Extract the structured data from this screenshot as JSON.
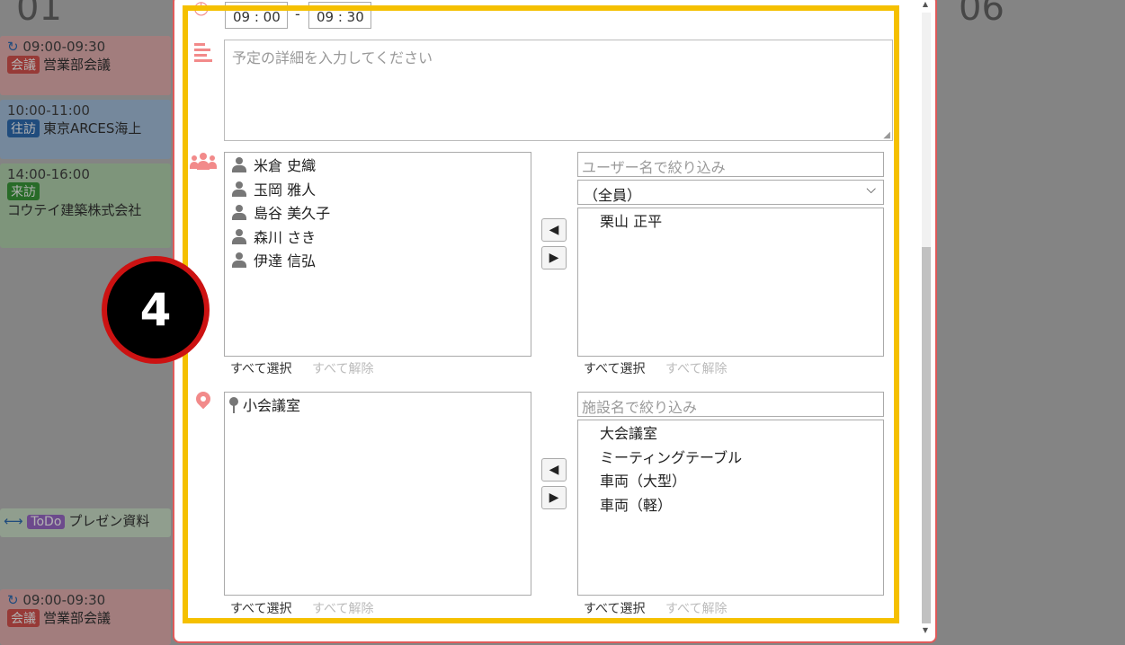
{
  "background": {
    "date_left": "01",
    "date_right": "06",
    "events": [
      {
        "time": "09:00-09:30",
        "tag": "会議",
        "tag_color": "#d9534f",
        "title": "営業部会議",
        "repeat": true
      },
      {
        "time": "10:00-11:00",
        "tag": "往訪",
        "tag_color": "#2e6db4",
        "title": "東京ARCES海上",
        "repeat": false
      },
      {
        "time": "14:00-16:00",
        "tag": "来訪",
        "tag_color": "#3a9a3a",
        "title": "コウテイ建築株式会社",
        "repeat": false
      },
      {
        "time": "09:00-09:30",
        "tag": "会議",
        "tag_color": "#d9534f",
        "title": "営業部会議",
        "repeat": true
      }
    ],
    "todo": {
      "tag": "ToDo",
      "title": "プレゼン資料"
    }
  },
  "dialog": {
    "time": {
      "start": "09 : 00",
      "separator": "-",
      "end": "09 : 30"
    },
    "detail_placeholder": "予定の詳細を入力してください",
    "participants": {
      "selected": [
        "米倉 史織",
        "玉岡 雅人",
        "島谷 美久子",
        "森川 さき",
        "伊達 信弘"
      ],
      "filter_placeholder": "ユーザー名で絞り込み",
      "group_select": "（全員）",
      "available": [
        "栗山 正平"
      ]
    },
    "facilities": {
      "selected": [
        "小会議室"
      ],
      "filter_placeholder": "施設名で絞り込み",
      "available": [
        "大会議室",
        "ミーティングテーブル",
        "車両（大型）",
        "車両（軽）"
      ]
    },
    "select_all": "すべて選択",
    "deselect_all": "すべて解除"
  },
  "step_number": "4",
  "colors": {
    "highlight": "#f5c000",
    "accent_icon": "#f28a8a",
    "step_ring": "#cc1212"
  }
}
